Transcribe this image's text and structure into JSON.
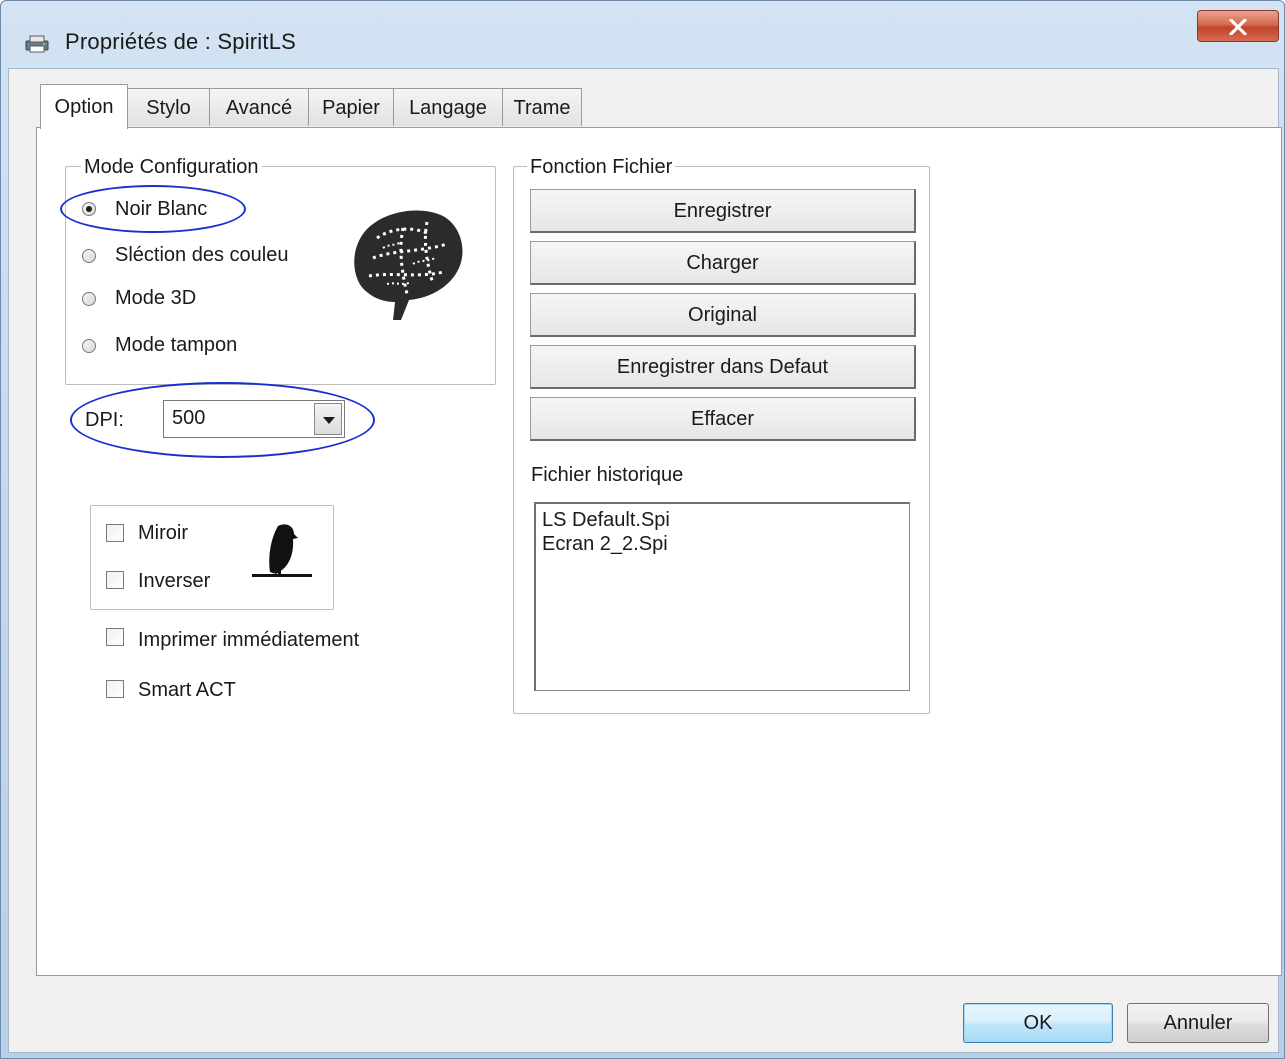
{
  "window": {
    "title": "Propriétés de : SpiritLS"
  },
  "tabs": [
    {
      "label": "Option",
      "active": true
    },
    {
      "label": "Stylo"
    },
    {
      "label": "Avancé"
    },
    {
      "label": "Papier"
    },
    {
      "label": "Langage"
    },
    {
      "label": "Trame"
    }
  ],
  "mode_config": {
    "title": "Mode Configuration",
    "options": [
      {
        "label": "Noir  Blanc",
        "selected": true
      },
      {
        "label": "Sléction des couleu",
        "selected": false
      },
      {
        "label": "Mode 3D",
        "selected": false
      },
      {
        "label": "Mode tampon",
        "selected": false
      }
    ]
  },
  "dpi": {
    "label": "DPI:",
    "value": "500"
  },
  "image_options": {
    "miroir": {
      "label": "Miroir",
      "checked": false
    },
    "inverser": {
      "label": "Inverser",
      "checked": false
    }
  },
  "imprimer": {
    "label": "Imprimer immédiatement",
    "checked": false
  },
  "smart_act": {
    "label": "Smart ACT",
    "checked": false
  },
  "fonction_fichier": {
    "title": "Fonction Fichier",
    "buttons": [
      "Enregistrer",
      "Charger",
      "Original",
      "Enregistrer dans Defaut",
      "Effacer"
    ],
    "history_label": "Fichier historique",
    "history": [
      "LS Default.Spi",
      "Ecran 2_2.Spi"
    ]
  },
  "footer": {
    "ok": "OK",
    "cancel": "Annuler"
  },
  "colors": {
    "annotation": "#1a2fd0",
    "close": "#c1442a",
    "ok_border": "#3c7fb1"
  },
  "icons": [
    "printer-icon",
    "close-icon",
    "brain-sketch-image",
    "bird-silhouette-image",
    "dropdown-arrow-icon"
  ]
}
